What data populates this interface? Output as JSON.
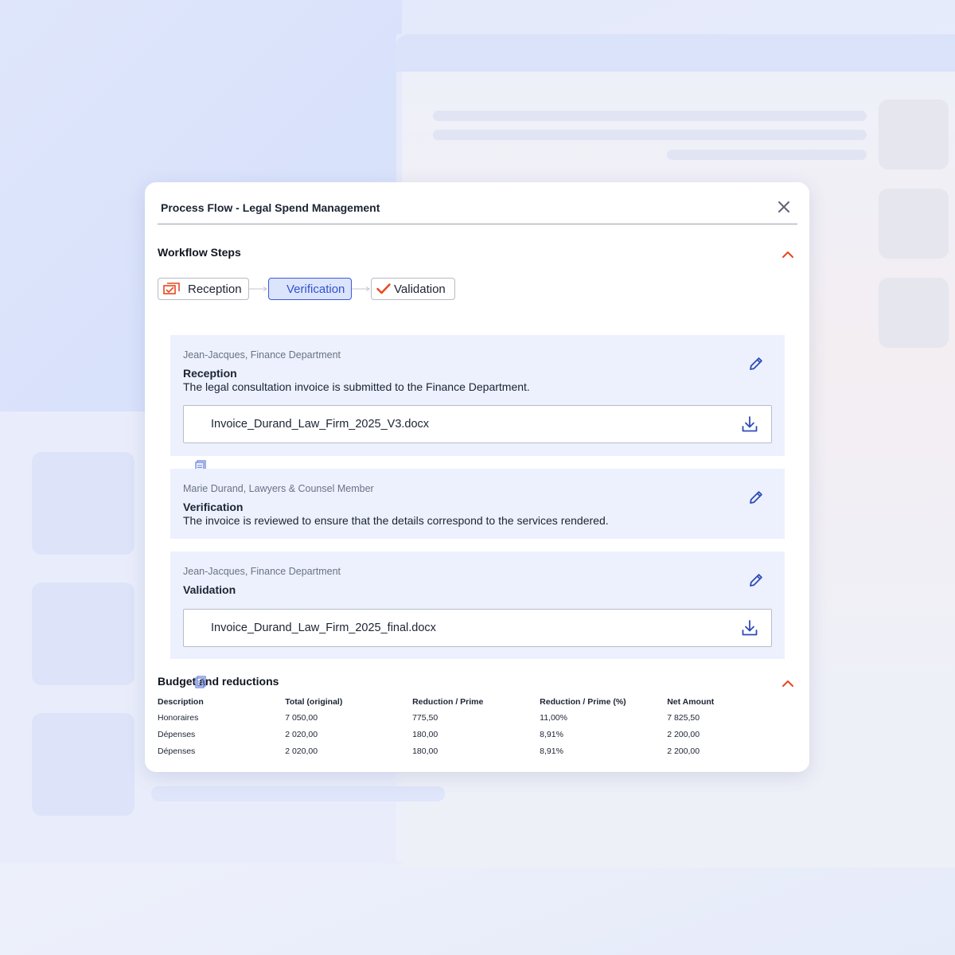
{
  "modal": {
    "title": "Process Flow - Legal Spend Management"
  },
  "workflow": {
    "section_title": "Workflow Steps",
    "steps": [
      {
        "label": "Reception",
        "icon": "reception-icon"
      },
      {
        "label": "Verification",
        "icon": "none",
        "active": true
      },
      {
        "label": "Validation",
        "icon": "check-icon"
      }
    ],
    "cards": [
      {
        "author": "Jean-Jacques, Finance Department",
        "step": "Reception",
        "description": "The legal consultation invoice is submitted to the Finance Department.",
        "file": "Invoice_Durand_Law_Firm_2025_V3.docx"
      },
      {
        "author": "Marie Durand, Lawyers & Counsel Member",
        "step": "Verification",
        "description": "The invoice is reviewed to ensure that the details correspond to the services rendered."
      },
      {
        "author": "Jean-Jacques, Finance Department",
        "step": "Validation",
        "file": "Invoice_Durand_Law_Firm_2025_final.docx"
      }
    ]
  },
  "budget": {
    "section_title": "Budget and reductions",
    "columns": [
      "Description",
      "Total (original)",
      "Reduction / Prime",
      "Reduction / Prime (%)",
      "Net Amount"
    ],
    "rows": [
      [
        "Honoraires",
        "7 050,00",
        "775,50",
        "11,00%",
        "7 825,50"
      ],
      [
        "Dépenses",
        "2 020,00",
        "180,00",
        "8,91%",
        "2 200,00"
      ],
      [
        "Dépenses",
        "2 020,00",
        "180,00",
        "8,91%",
        "2 200,00"
      ]
    ]
  },
  "colors": {
    "accent": "#e8471d",
    "primary_blue": "#3252d0",
    "card_bg": "#ecf1fd",
    "active_step_bg": "#dbe4fb"
  }
}
